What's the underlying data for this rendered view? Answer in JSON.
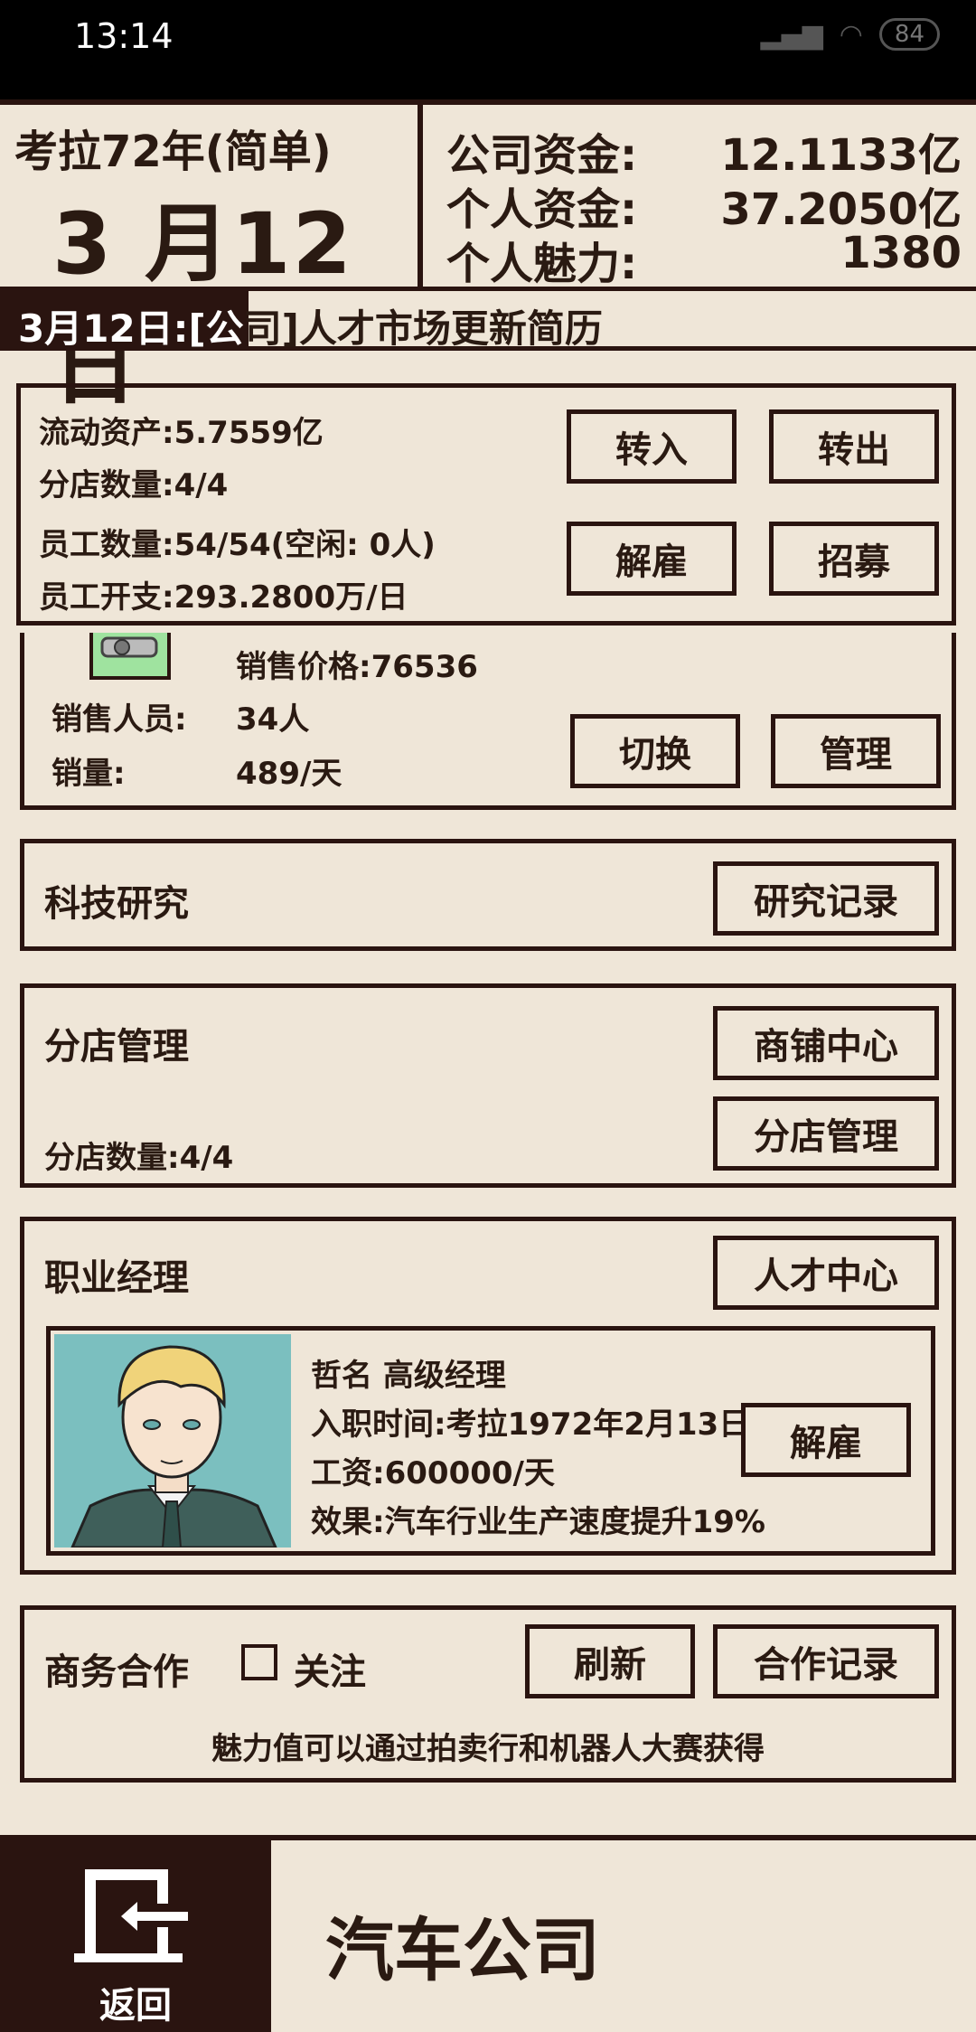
{
  "status_bar": {
    "time": "13:14",
    "signal": "HD",
    "battery": "84"
  },
  "header": {
    "year_label": "考拉72年(简单)",
    "date_label": "3 月12日",
    "company_funds_label": "公司资金:",
    "company_funds_value": "12.1133亿",
    "personal_funds_label": "个人资金:",
    "personal_funds_value": "37.2050亿",
    "charisma_label": "个人魅力:",
    "charisma_value": "1380"
  },
  "ticker": {
    "prefix": "3月12日:[公",
    "rest": "司]人才市场更新简历"
  },
  "assets_panel": {
    "current_assets": "流动资产:5.7559亿",
    "branch_count": "分店数量:4/4",
    "employee_count": "员工数量:54/54(空闲: 0人)",
    "employee_cost": "员工开支:293.2800万/日",
    "transfer_in": "转入",
    "transfer_out": "转出",
    "dismiss": "解雇",
    "recruit": "招募"
  },
  "sales_panel": {
    "price": "销售价格:76536",
    "sales_staff_label": "销售人员:",
    "sales_staff_value": "34人",
    "sales_volume_label": "销量:",
    "sales_volume_value": "489/天",
    "switch": "切换",
    "manage": "管理"
  },
  "research_panel": {
    "title": "科技研究",
    "records": "研究记录"
  },
  "branch_panel": {
    "title": "分店管理",
    "shop_center": "商铺中心",
    "branch_manage": "分店管理",
    "branch_count": "分店数量:4/4"
  },
  "manager_panel": {
    "title": "职业经理",
    "talent_center": "人才中心",
    "name": "哲名 高级经理",
    "hire_date": "入职时间:考拉1972年2月13日",
    "salary": "工资:600000/天",
    "effect": "效果:汽车行业生产速度提升19%",
    "dismiss": "解雇"
  },
  "business_panel": {
    "title": "商务合作",
    "follow": "关注",
    "refresh": "刷新",
    "records": "合作记录",
    "hint": "魅力值可以通过拍卖行和机器人大赛获得"
  },
  "bottom_bar": {
    "back": "返回",
    "company_name": "汽车公司"
  },
  "colors": {
    "background": "#efe6d8",
    "dark": "#2a1410",
    "portrait_bg": "#7bbfbf"
  }
}
